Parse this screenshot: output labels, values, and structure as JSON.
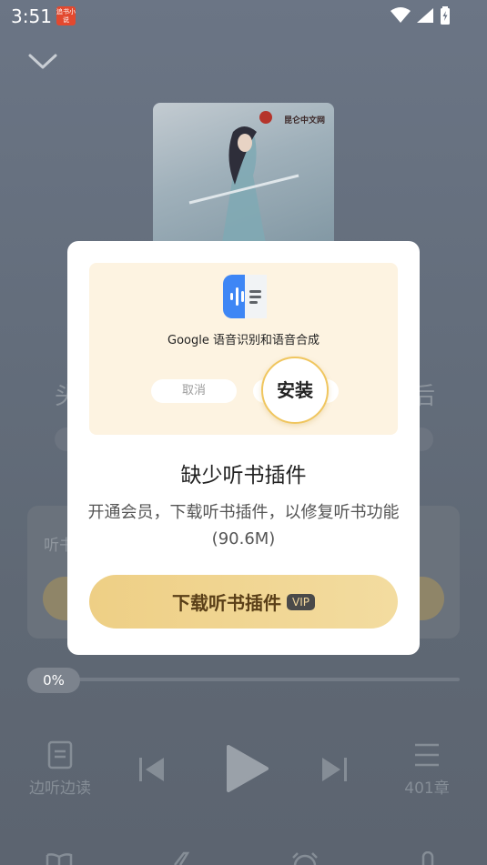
{
  "status_bar": {
    "time": "3:51",
    "app_icon_label": "追书小说"
  },
  "background": {
    "cover": {
      "publisher": "昆仑中文网"
    },
    "progress_label": "0%",
    "controls": {
      "read_while_listening": "边听边读",
      "chapters": "401章"
    }
  },
  "dialog": {
    "illustration": {
      "plugin_name": "Google 语音识别和语音合成",
      "cancel_label": "取消",
      "install_label": "安装"
    },
    "title": "缺少听书插件",
    "description": "开通会员，下载听书插件，以修复听书功能(90.6M)",
    "download_button": "下载听书插件",
    "vip_badge": "VIP"
  },
  "colors": {
    "accent_gold": "#eecf85",
    "dialog_bg": "#ffffff",
    "illustration_bg": "#fdf3e1"
  }
}
